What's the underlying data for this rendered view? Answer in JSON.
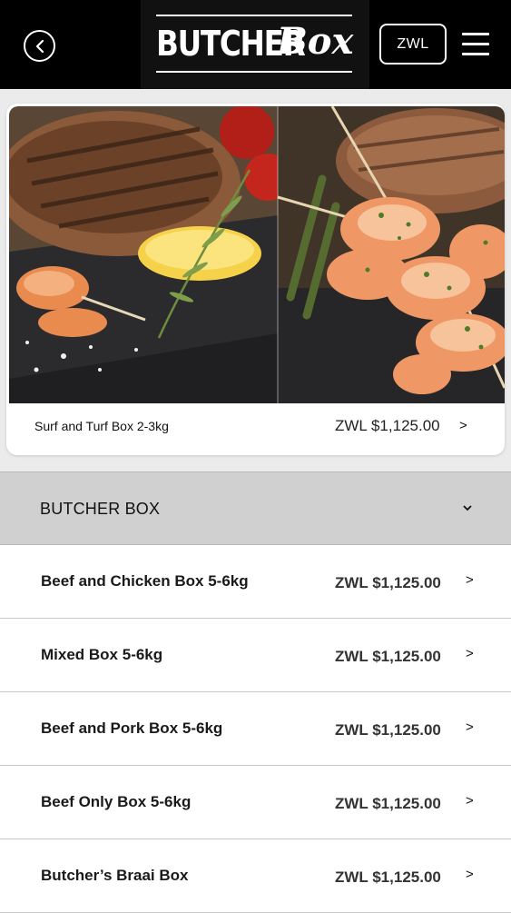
{
  "header": {
    "back_icon": "chevron-left-icon",
    "logo": {
      "word1": "BUTCHER",
      "word2": "Box"
    },
    "currency": "ZWL",
    "menu_icon": "hamburger-menu-icon",
    "background": "#000000"
  },
  "featured": {
    "name": "Surf and Turf Box 2-3kg",
    "price": "ZWL $1,125.00",
    "chevron": ">"
  },
  "category": {
    "label": "BUTCHER BOX",
    "chevron": "⌄"
  },
  "products": [
    {
      "name": "Beef and Chicken Box 5-6kg",
      "price": "ZWL $1,125.00",
      "chevron": ">"
    },
    {
      "name": "Mixed Box 5-6kg",
      "price": "ZWL $1,125.00",
      "chevron": ">"
    },
    {
      "name": "Beef and Pork Box 5-6kg",
      "price": "ZWL $1,125.00",
      "chevron": ">"
    },
    {
      "name": "Beef Only Box 5-6kg",
      "price": "ZWL $1,125.00",
      "chevron": ">"
    },
    {
      "name": "Butcher’s Braai Box",
      "price": "ZWL $1,125.00",
      "chevron": ">"
    }
  ]
}
